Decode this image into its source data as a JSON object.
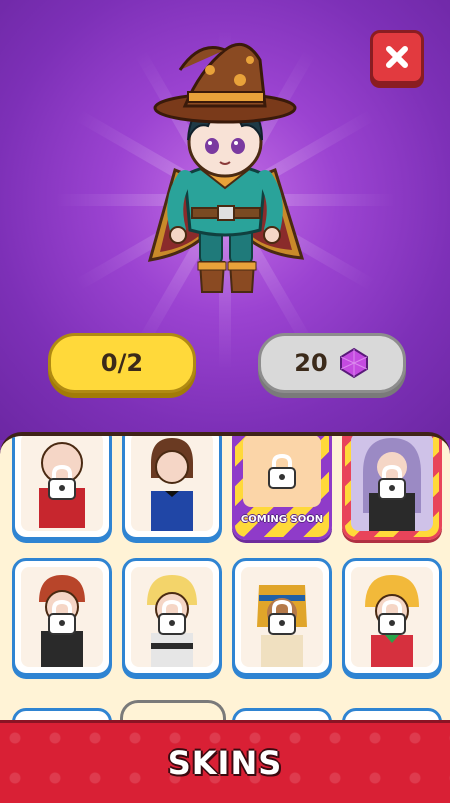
{
  "header": {
    "close_icon": "close-x-icon",
    "character": "wizard-boy-character"
  },
  "stats": {
    "progress": "0/2",
    "gems": "20",
    "gem_icon": "purple-gem-icon"
  },
  "skins": [
    {
      "row": 1,
      "col": 1,
      "locked": true,
      "label": ""
    },
    {
      "row": 1,
      "col": 2,
      "locked": false,
      "label": ""
    },
    {
      "row": 1,
      "col": 3,
      "locked": true,
      "label": "COMING SOON"
    },
    {
      "row": 1,
      "col": 4,
      "locked": true,
      "label": ""
    },
    {
      "row": 2,
      "col": 1,
      "locked": true,
      "label": ""
    },
    {
      "row": 2,
      "col": 2,
      "locked": true,
      "label": ""
    },
    {
      "row": 2,
      "col": 3,
      "locked": true,
      "label": ""
    },
    {
      "row": 2,
      "col": 4,
      "locked": true,
      "label": ""
    }
  ],
  "footer": {
    "title": "SKINS"
  },
  "colors": {
    "accent_yellow": "#ffd93a",
    "card_border": "#2f84d2",
    "footer_red": "#d92035",
    "background_purple": "#9b43d1"
  }
}
